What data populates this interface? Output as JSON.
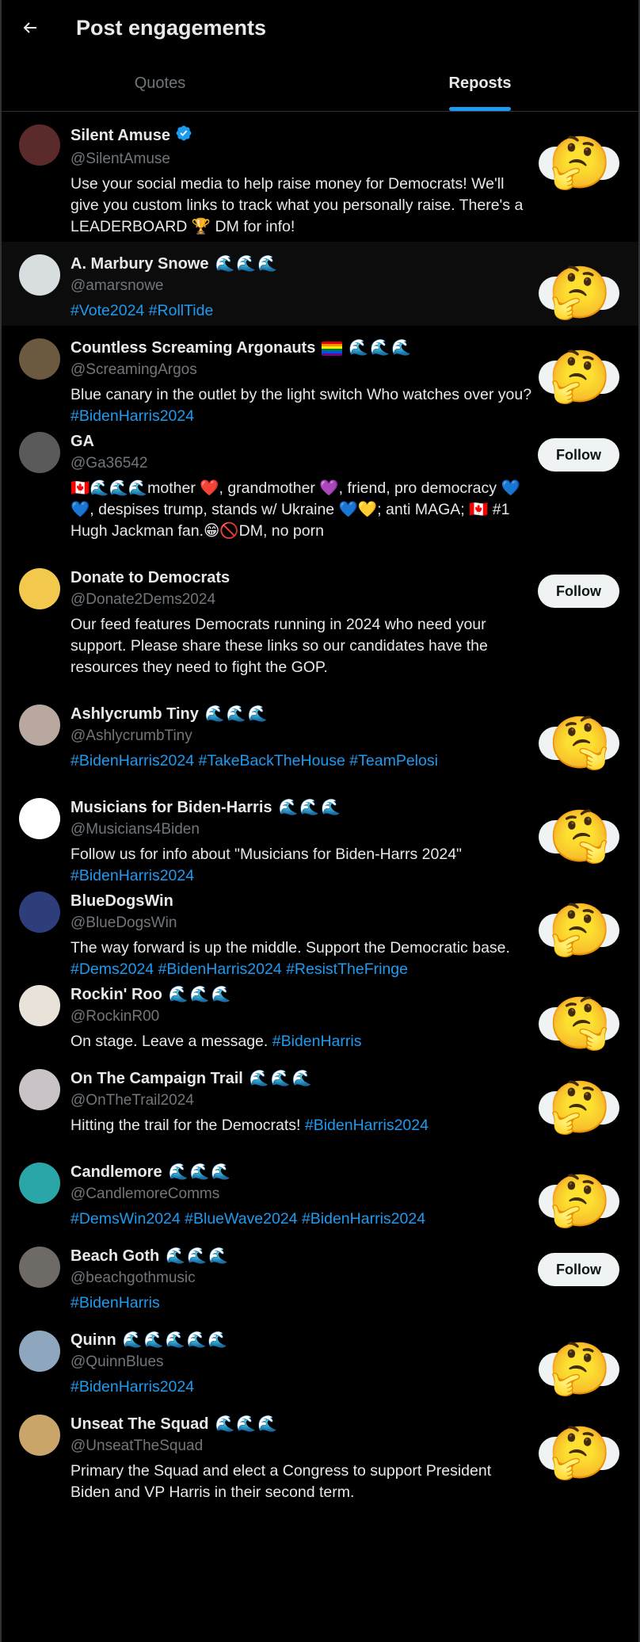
{
  "header": {
    "title": "Post engagements",
    "back_icon": "arrow-left-icon"
  },
  "tabs": [
    {
      "label": "Quotes",
      "active": false
    },
    {
      "label": "Reposts",
      "active": true
    }
  ],
  "colors": {
    "accent": "#1d9bf0",
    "text": "#e7e9ea",
    "muted": "#71767b",
    "background": "#000000"
  },
  "users": [
    {
      "name": "Silent Amuse",
      "verified": true,
      "badges": "",
      "handle": "@SilentAmuse",
      "bio": "Use your social media to help raise money for Democrats! We'll give you custom links to track what you personally raise. There's a LEADERBOARD 🏆 DM for info!",
      "tags": "",
      "action": "think",
      "avatar": "#5b2a2a"
    },
    {
      "name": "A. Marbury Snowe",
      "verified": false,
      "badges": "🌊🌊🌊",
      "handle": "@amarsnowe",
      "bio": "",
      "tags": "#Vote2024 #RollTide",
      "action": "think",
      "avatar": "#d8dde0"
    },
    {
      "name": "Countless Screaming Argonauts",
      "verified": false,
      "badges": "🌊🌊🌊",
      "rainbow": true,
      "handle": "@ScreamingArgos",
      "bio": "Blue canary in the outlet by the light switch Who watches over you?",
      "tags": "#BidenHarris2024",
      "action": "think",
      "avatar": "#6b5a40"
    },
    {
      "name": "GA",
      "verified": false,
      "badges": "",
      "handle": "@Ga36542",
      "bio": "🇨🇦🌊🌊🌊mother ❤️, grandmother 💜, friend, pro democracy 💙💙, despises trump, stands w/ Ukraine 💙💛; anti MAGA; 🇨🇦 #1 Hugh Jackman fan.😁🚫DM, no porn",
      "tags": "",
      "action": "follow",
      "follow_label": "Follow",
      "avatar": "#5a5a5a"
    },
    {
      "name": "Donate to Democrats",
      "verified": false,
      "badges": "",
      "handle": "@Donate2Dems2024",
      "bio": "Our feed features Democrats running in 2024 who need your support. Please share these links so our candidates have the resources they need to fight the GOP.",
      "tags": "",
      "action": "follow",
      "follow_label": "Follow",
      "avatar": "#f2c94c"
    },
    {
      "name": "Ashlycrumb Tiny",
      "verified": false,
      "badges": "🌊🌊🌊",
      "handle": "@AshlycrumbTiny",
      "bio": "",
      "tags": "#BidenHarris2024 #TakeBackTheHouse #TeamPelosi",
      "action": "think-flip",
      "avatar": "#b8a8a0"
    },
    {
      "name": "Musicians for Biden-Harris",
      "verified": false,
      "badges": "🌊🌊🌊",
      "handle": "@Musicians4Biden",
      "bio": "Follow us for info about \"Musicians for Biden-Harrs 2024\"",
      "tags": "#BidenHarris2024",
      "action": "think-flip",
      "avatar": "#ffffff"
    },
    {
      "name": "BlueDogsWin",
      "verified": false,
      "badges": "",
      "handle": "@BlueDogsWin",
      "bio": "The way forward is up the middle. Support the Democratic base.",
      "tags": "#Dems2024 #BidenHarris2024 #ResistTheFringe",
      "action": "think",
      "avatar": "#2d3e7a"
    },
    {
      "name": "Rockin' Roo",
      "verified": false,
      "badges": "🌊🌊🌊",
      "handle": "@RockinR00",
      "bio": "On stage. Leave a message.",
      "tags": "#BidenHarris",
      "action": "think-flip",
      "avatar": "#e8e2d8"
    },
    {
      "name": "On The Campaign Trail",
      "verified": false,
      "badges": "🌊🌊🌊",
      "handle": "@OnTheTrail2024",
      "bio": "Hitting the trail for the Democrats!",
      "tags": "#BidenHarris2024",
      "action": "think",
      "avatar": "#c9c3c8"
    },
    {
      "name": "Candlemore",
      "verified": false,
      "badges": "🌊🌊🌊",
      "handle": "@CandlemoreComms",
      "bio": "",
      "tags": "#DemsWin2024 #BlueWave2024 #BidenHarris2024",
      "action": "think",
      "avatar": "#2aa6a8"
    },
    {
      "name": "Beach Goth",
      "verified": false,
      "badges": "🌊🌊🌊",
      "handle": "@beachgothmusic",
      "bio": "",
      "tags": "#BidenHarris",
      "action": "follow",
      "follow_label": "Follow",
      "avatar": "#6e6a66"
    },
    {
      "name": "Quinn",
      "verified": false,
      "badges": "🌊🌊🌊🌊🌊",
      "handle": "@QuinnBlues",
      "bio": "",
      "tags": "#BidenHarris2024",
      "action": "think",
      "avatar": "#8fa6bf"
    },
    {
      "name": "Unseat The Squad",
      "verified": false,
      "badges": "🌊🌊🌊",
      "handle": "@UnseatTheSquad",
      "bio": "Primary the Squad and elect a Congress to support President Biden and VP Harris in their second term.",
      "tags": "",
      "action": "think",
      "avatar": "#c9a56a"
    }
  ]
}
